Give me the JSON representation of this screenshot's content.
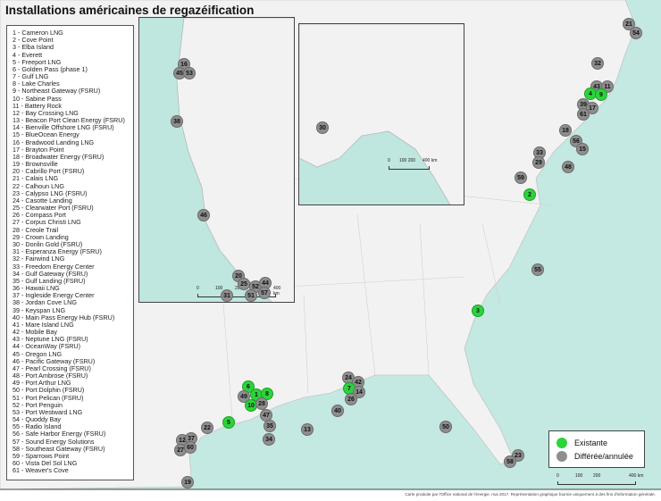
{
  "title": "Installations américaines de regazéification",
  "facilities": [
    "1 - Cameron LNG",
    "2 - Cove Point",
    "3 - Elba Island",
    "4 - Everett",
    "5 - Freeport LNG",
    "6 - Golden Pass (phase 1)",
    "7 - Gulf LNG",
    "8 - Lake Charles",
    "9 - Northeast Gateway (FSRU)",
    "10 - Sabine Pass",
    "11 - Battery Rock",
    "12 - Bay Crossing LNG",
    "13 - Beacon Port Clean Energy (FSRU)",
    "14 - Bienville Offshore LNG (FSRU)",
    "15 - BlueOcean Energy",
    "16 - Bradwood Landing LNG",
    "17 - Brayton Point",
    "18 - Broadwater Energy (FSRU)",
    "19 - Brownsville",
    "20 - Cabrillo Port (FSRU)",
    "21 - Calais LNG",
    "22 - Calhoun LNG",
    "23 - Calypso LNG (FSRU)",
    "24 - Casotte Landing",
    "25 - Clearwater Port (FSRU)",
    "26 - Compass Port",
    "27 - Corpus Christi LNG",
    "28 - Creole Trail",
    "29 - Crown Landing",
    "30 - Donlin Gold (FSRU)",
    "31 - Esperanza Energy (FSRU)",
    "32 - Fairwind LNG",
    "33 - Freedom Energy Center",
    "34 - Gulf Gateway (FSRU)",
    "35 - Gulf Landing (FSRU)",
    "36 - Hawaii LNG",
    "37 - Ingleside Energy Center",
    "38 - Jordan Cove LNG",
    "39 - Keyspan LNG",
    "40 - Main Pass Energy Hub (FSRU)",
    "41 - Mare Island LNG",
    "42 - Mobile Bay",
    "43 - Neptune LNG (FSRU)",
    "44 - OceanWay (FSRU)",
    "45 - Oregon LNG",
    "46 - Pacific Gateway (FSRU)",
    "47 - Pearl Crossing (FSRU)",
    "48 - Port Ambrose (FSRU)",
    "49 - Port Arthur LNG",
    "50 - Port Dolphin (FSRU)",
    "51 - Port Pelican (FSRU)",
    "52 - Port Penguin",
    "53 - Port Westward LNG",
    "54 - Quoddy Bay",
    "55 - Radio Island",
    "56 - Safe Harbor Energy (FSRU)",
    "57 - Sound Energy Solutions",
    "58 - Southeast Gateway (FSRU)",
    "59 - Sparrows Point",
    "60 - Vista Del Sol LNG",
    "61 - Weaver's Cove"
  ],
  "markers": [
    {
      "n": "21",
      "status": "deferred"
    },
    {
      "n": "54",
      "status": "deferred"
    },
    {
      "n": "32",
      "status": "deferred"
    },
    {
      "n": "43",
      "status": "deferred"
    },
    {
      "n": "11",
      "status": "deferred"
    },
    {
      "n": "4",
      "status": "existing"
    },
    {
      "n": "9",
      "status": "existing"
    },
    {
      "n": "39",
      "status": "deferred"
    },
    {
      "n": "17",
      "status": "deferred"
    },
    {
      "n": "61",
      "status": "deferred"
    },
    {
      "n": "18",
      "status": "deferred"
    },
    {
      "n": "56",
      "status": "deferred"
    },
    {
      "n": "15",
      "status": "deferred"
    },
    {
      "n": "33",
      "status": "deferred"
    },
    {
      "n": "29",
      "status": "deferred"
    },
    {
      "n": "48",
      "status": "deferred"
    },
    {
      "n": "59",
      "status": "deferred"
    },
    {
      "n": "2",
      "status": "existing"
    },
    {
      "n": "55",
      "status": "deferred"
    },
    {
      "n": "3",
      "status": "existing"
    },
    {
      "n": "6",
      "status": "existing"
    },
    {
      "n": "49",
      "status": "deferred"
    },
    {
      "n": "1",
      "status": "existing"
    },
    {
      "n": "8",
      "status": "existing"
    },
    {
      "n": "10",
      "status": "existing"
    },
    {
      "n": "28",
      "status": "deferred"
    },
    {
      "n": "24",
      "status": "deferred"
    },
    {
      "n": "42",
      "status": "deferred"
    },
    {
      "n": "7",
      "status": "existing"
    },
    {
      "n": "14",
      "status": "deferred"
    },
    {
      "n": "26",
      "status": "deferred"
    },
    {
      "n": "40",
      "status": "deferred"
    },
    {
      "n": "47",
      "status": "deferred"
    },
    {
      "n": "35",
      "status": "deferred"
    },
    {
      "n": "5",
      "status": "existing"
    },
    {
      "n": "22",
      "status": "deferred"
    },
    {
      "n": "13",
      "status": "deferred"
    },
    {
      "n": "34",
      "status": "deferred"
    },
    {
      "n": "50",
      "status": "deferred"
    },
    {
      "n": "12",
      "status": "deferred"
    },
    {
      "n": "37",
      "status": "deferred"
    },
    {
      "n": "27",
      "status": "deferred"
    },
    {
      "n": "60",
      "status": "deferred"
    },
    {
      "n": "23",
      "status": "deferred"
    },
    {
      "n": "58",
      "status": "deferred"
    },
    {
      "n": "19",
      "status": "deferred"
    },
    {
      "n": "16",
      "status": "deferred"
    },
    {
      "n": "45",
      "status": "deferred"
    },
    {
      "n": "53",
      "status": "deferred"
    },
    {
      "n": "38",
      "status": "deferred"
    },
    {
      "n": "46",
      "status": "deferred"
    },
    {
      "n": "20",
      "status": "deferred"
    },
    {
      "n": "25",
      "status": "deferred"
    },
    {
      "n": "52",
      "status": "deferred"
    },
    {
      "n": "44",
      "status": "deferred"
    },
    {
      "n": "31",
      "status": "deferred"
    },
    {
      "n": "51",
      "status": "deferred"
    },
    {
      "n": "57",
      "status": "deferred"
    },
    {
      "n": "30",
      "status": "deferred"
    }
  ],
  "legend": {
    "existing": "Existante",
    "deferred": "Différée/annulée"
  },
  "colors": {
    "existing": "#2bd43a",
    "deferred": "#8e8e8e",
    "sea": "#c4e8e2",
    "land": "#f2f2f2"
  },
  "scale_main": [
    "0",
    "100",
    "200",
    "400 km"
  ],
  "scale_west": [
    "0",
    "100",
    "200",
    "400 km"
  ],
  "scale_alaska": [
    "0",
    "100 200",
    "400 km"
  ],
  "footer": "Carte produite par l'Office national de l'énergie, mai 2017. Représentation graphique fournie uniquement à des fins d'information générale."
}
